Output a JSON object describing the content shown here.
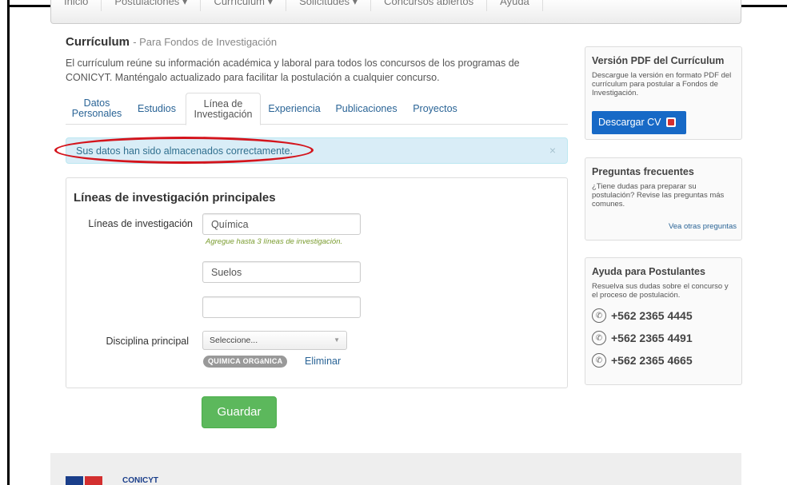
{
  "nav": {
    "items": [
      "Inicio",
      "Postulaciones ▾",
      "Currículum ▾",
      "Solicitudes ▾",
      "Concursos abiertos",
      "Ayuda"
    ]
  },
  "header": {
    "title": "Currículum",
    "subtitle": "- Para Fondos de Investigación",
    "intro": "El currículum reúne su información académica y laboral para todos los concursos de los programas de CONICYT. Manténgalo actualizado para facilitar la postulación a cualquier concurso."
  },
  "tabs": [
    {
      "label": "Datos Personales"
    },
    {
      "label": "Estudios"
    },
    {
      "label": "Línea de Investigación"
    },
    {
      "label": "Experiencia"
    },
    {
      "label": "Publicaciones"
    },
    {
      "label": "Proyectos"
    }
  ],
  "alert": {
    "message": "Sus datos han sido almacenados correctamente.",
    "close": "×"
  },
  "form": {
    "heading": "Líneas de investigación principales",
    "lines_label": "Líneas de investigación",
    "line1": "Química",
    "line2": "Suelos",
    "line3": "",
    "help": "Agregue hasta 3 líneas de investigación.",
    "discipline_label": "Disciplina principal",
    "discipline_select": "Seleccione...",
    "discipline_tag": "QUIMICA ORGáNICA",
    "remove_link": "Eliminar",
    "save": "Guardar"
  },
  "sidebar": {
    "pdf": {
      "title": "Versión PDF del Currículum",
      "text": "Descargue la versión en formato PDF del currículum para postular a Fondos de Investigación.",
      "button": "Descargar CV"
    },
    "faq": {
      "title": "Preguntas frecuentes",
      "text": "¿Tiene dudas para preparar su postulación? Revise las preguntas más comunes.",
      "link": "Vea otras preguntas"
    },
    "help": {
      "title": "Ayuda para Postulantes",
      "text": "Resuelva sus dudas sobre el concurso y el proceso de postulación.",
      "phones": [
        "+562 2365 4445",
        "+562 2365 4491",
        "+562 2365 4665"
      ]
    }
  },
  "footer": {
    "name": "CONICYT"
  }
}
